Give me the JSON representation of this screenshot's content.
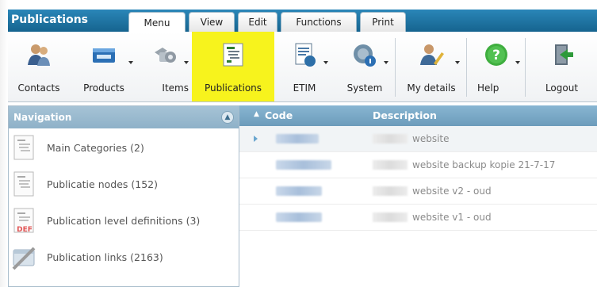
{
  "app": {
    "title": "Publications"
  },
  "tabs": [
    {
      "label": "Menu"
    },
    {
      "label": "View"
    },
    {
      "label": "Edit"
    },
    {
      "label": "Functions"
    },
    {
      "label": "Print"
    }
  ],
  "ribbon": [
    {
      "label": "Contacts",
      "icon": "contacts-icon"
    },
    {
      "label": "Products",
      "icon": "products-icon"
    },
    {
      "label": "Items",
      "icon": "items-icon"
    },
    {
      "label": "Publications",
      "icon": "publications-icon",
      "selected": true
    },
    {
      "label": "ETIM",
      "icon": "etim-icon"
    },
    {
      "label": "System",
      "icon": "system-icon"
    },
    {
      "label": "My details",
      "icon": "my-details-icon"
    },
    {
      "label": "Help",
      "icon": "help-icon"
    },
    {
      "label": "Logout",
      "icon": "logout-icon"
    }
  ],
  "nav": {
    "title": "Navigation",
    "items": [
      {
        "label": "Main Categories (2)",
        "icon": "document-icon"
      },
      {
        "label": "Publicatie nodes (152)",
        "icon": "document-icon"
      },
      {
        "label": "Publication level definitions (3)",
        "icon": "document-def-icon"
      },
      {
        "label": "Publication links (2163)",
        "icon": "link-icon"
      }
    ]
  },
  "grid": {
    "columns": {
      "code": "Code",
      "description": "Description"
    },
    "rows": [
      {
        "description": "website"
      },
      {
        "description": "website backup kopie 21-7-17"
      },
      {
        "description": "website v2 - oud"
      },
      {
        "description": "website v1 - oud"
      }
    ]
  },
  "colors": {
    "tabbar": "#1d74a4",
    "selected_ribbon": "#f7f31d",
    "grid_header": "#7aa9c6",
    "nav_header": "#99b9cf"
  }
}
